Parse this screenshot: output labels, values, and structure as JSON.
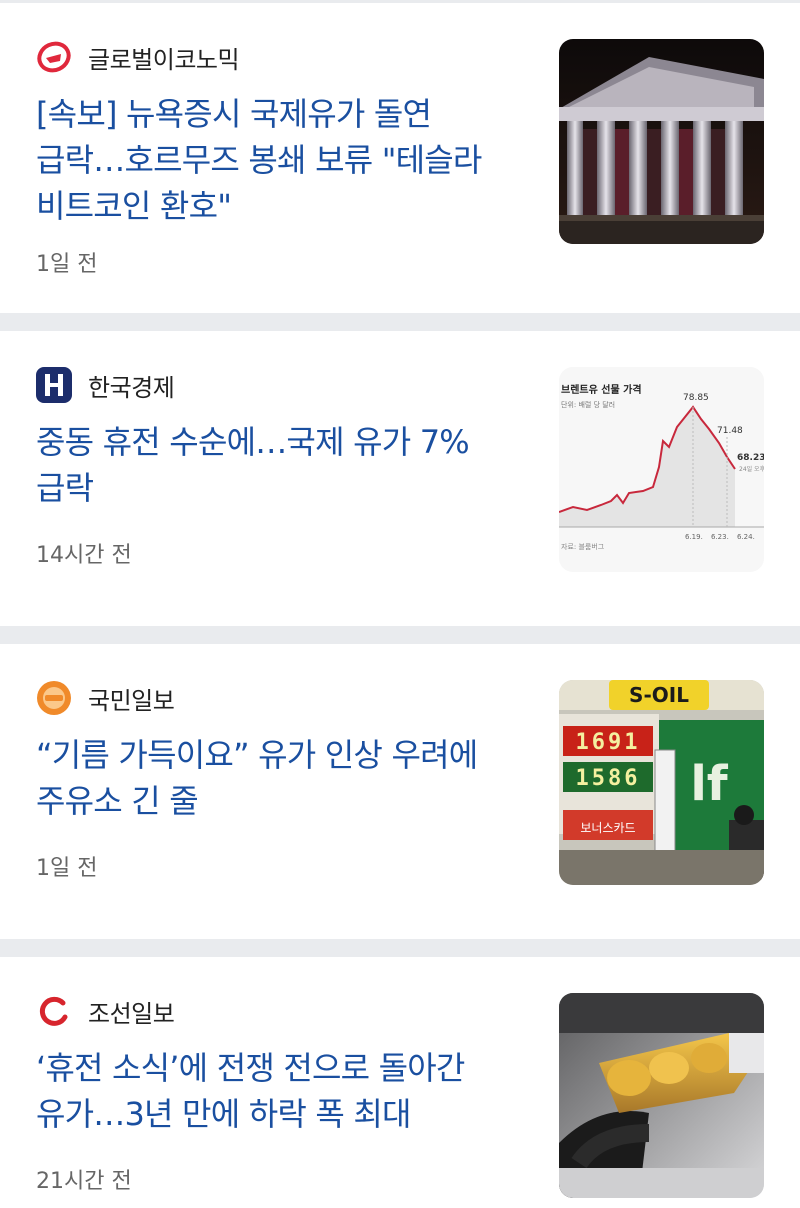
{
  "articles": [
    {
      "source": "글로벌이코노믹",
      "logo_icon": "globaleconomic-logo-icon",
      "headline": "[속보] 뉴욕증시 국제유가 돌연 급락…호르무즈 봉쇄 보류 \"테슬라 비트코인 환호\"",
      "time": "1일 전",
      "thumbnail": "stock-exchange-building-photo"
    },
    {
      "source": "한국경제",
      "logo_icon": "hankyung-logo-icon",
      "headline": "중동 휴전 수순에…국제 유가 7% 급락",
      "time": "14시간 전",
      "thumbnail": "oil-price-chart-image",
      "thumb_chart": {
        "title": "브렌트유 선물 가격",
        "subtitle": "단위: 배럴 당 달러",
        "peak_label": "78.85",
        "mid_label": "71.48",
        "end_label": "68.23",
        "end_note": "24일 오후",
        "x_labels": [
          "6.19.",
          "6.23.",
          "6.24."
        ],
        "source_note": "자료: 블룸버그"
      }
    },
    {
      "source": "국민일보",
      "logo_icon": "kukmin-logo-icon",
      "headline": "“기름 가득이요” 유가 인상 우려에 주유소 긴 줄",
      "time": "1일 전",
      "thumbnail": "gas-station-price-sign-photo",
      "thumb_sign": {
        "brand": "S-OIL",
        "price1": "1691",
        "price2": "1586",
        "bonus": "보너스카드"
      }
    },
    {
      "source": "조선일보",
      "logo_icon": "chosun-logo-icon",
      "headline": "‘휴전 소식’에 전쟁 전으로 돌아간 유가…3년 만에 하락 폭 최대",
      "time": "21시간 전",
      "thumbnail": "fuel-nozzle-photo"
    }
  ],
  "colors": {
    "headline": "#1a4fa0",
    "separator": "#e9ebee",
    "globaleconomic": "#e0283c",
    "hankyung": "#1c2d6b",
    "kukmin": "#f08a2a",
    "chosun": "#d7252d"
  }
}
